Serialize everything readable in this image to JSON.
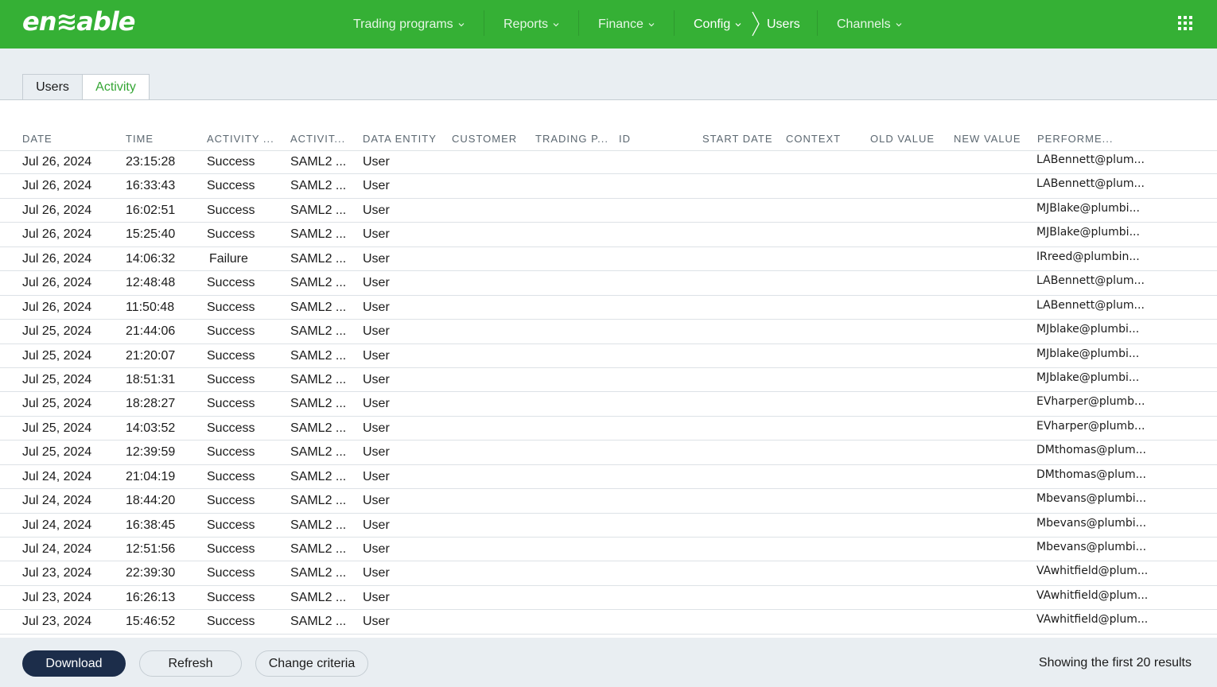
{
  "header": {
    "logo_text": "en≋able",
    "nav": [
      {
        "label": "Trading programs"
      },
      {
        "label": "Reports"
      },
      {
        "label": "Finance"
      },
      {
        "label": "Config"
      },
      {
        "label": "Users"
      },
      {
        "label": "Channels"
      }
    ],
    "brand_color": "#35b035"
  },
  "tabs": {
    "users": "Users",
    "activity": "Activity"
  },
  "table": {
    "columns": [
      "DATE",
      "TIME",
      "ACTIVITY ...",
      "ACTIVIT...",
      "DATA ENTITY",
      "CUSTOMER",
      "TRADING P...",
      "ID",
      "START DATE",
      "CONTEXT",
      "OLD VALUE",
      "NEW VALUE",
      "PERFORME..."
    ],
    "rows": [
      {
        "date": "Jul 26, 2024",
        "time": "23:15:28",
        "result": "Success",
        "activity": "SAML2 ...",
        "entity": "User",
        "performer": "LABennett@plum..."
      },
      {
        "date": "Jul 26, 2024",
        "time": "16:33:43",
        "result": "Success",
        "activity": "SAML2 ...",
        "entity": "User",
        "performer": "LABennett@plum..."
      },
      {
        "date": "Jul 26, 2024",
        "time": "16:02:51",
        "result": "Success",
        "activity": "SAML2 ...",
        "entity": "User",
        "performer": "MJBlake@plumbi..."
      },
      {
        "date": "Jul 26, 2024",
        "time": "15:25:40",
        "result": "Success",
        "activity": "SAML2 ...",
        "entity": "User",
        "performer": "MJBlake@plumbi..."
      },
      {
        "date": "Jul 26, 2024",
        "time": "14:06:32",
        "result": "Failure",
        "activity": "SAML2 ...",
        "entity": "User",
        "performer": "IRreed@plumbin..."
      },
      {
        "date": "Jul 26, 2024",
        "time": "12:48:48",
        "result": "Success",
        "activity": "SAML2 ...",
        "entity": "User",
        "performer": "LABennett@plum..."
      },
      {
        "date": "Jul 26, 2024",
        "time": "11:50:48",
        "result": "Success",
        "activity": "SAML2 ...",
        "entity": "User",
        "performer": "LABennett@plum..."
      },
      {
        "date": "Jul 25, 2024",
        "time": "21:44:06",
        "result": "Success",
        "activity": "SAML2 ...",
        "entity": "User",
        "performer": "MJblake@plumbi..."
      },
      {
        "date": "Jul 25, 2024",
        "time": "21:20:07",
        "result": "Success",
        "activity": "SAML2 ...",
        "entity": "User",
        "performer": "MJblake@plumbi..."
      },
      {
        "date": "Jul 25, 2024",
        "time": "18:51:31",
        "result": "Success",
        "activity": "SAML2 ...",
        "entity": "User",
        "performer": "MJblake@plumbi..."
      },
      {
        "date": "Jul 25, 2024",
        "time": "18:28:27",
        "result": "Success",
        "activity": "SAML2 ...",
        "entity": "User",
        "performer": "EVharper@plumb..."
      },
      {
        "date": "Jul 25, 2024",
        "time": "14:03:52",
        "result": "Success",
        "activity": "SAML2 ...",
        "entity": "User",
        "performer": "EVharper@plumb..."
      },
      {
        "date": "Jul 25, 2024",
        "time": "12:39:59",
        "result": "Success",
        "activity": "SAML2 ...",
        "entity": "User",
        "performer": "DMthomas@plum..."
      },
      {
        "date": "Jul 24, 2024",
        "time": "21:04:19",
        "result": "Success",
        "activity": "SAML2 ...",
        "entity": "User",
        "performer": "DMthomas@plum..."
      },
      {
        "date": "Jul 24, 2024",
        "time": "18:44:20",
        "result": "Success",
        "activity": "SAML2 ...",
        "entity": "User",
        "performer": "Mbevans@plumbi..."
      },
      {
        "date": "Jul 24, 2024",
        "time": "16:38:45",
        "result": "Success",
        "activity": "SAML2 ...",
        "entity": "User",
        "performer": "Mbevans@plumbi..."
      },
      {
        "date": "Jul 24, 2024",
        "time": "12:51:56",
        "result": "Success",
        "activity": "SAML2 ...",
        "entity": "User",
        "performer": "Mbevans@plumbi..."
      },
      {
        "date": "Jul 23, 2024",
        "time": "22:39:30",
        "result": "Success",
        "activity": "SAML2 ...",
        "entity": "User",
        "performer": "VAwhitfield@plum..."
      },
      {
        "date": "Jul 23, 2024",
        "time": "16:26:13",
        "result": "Success",
        "activity": "SAML2 ...",
        "entity": "User",
        "performer": "VAwhitfield@plum..."
      },
      {
        "date": "Jul 23, 2024",
        "time": "15:46:52",
        "result": "Success",
        "activity": "SAML2 ...",
        "entity": "User",
        "performer": "VAwhitfield@plum..."
      }
    ]
  },
  "footer": {
    "download": "Download",
    "refresh": "Refresh",
    "change_criteria": "Change criteria",
    "results_text": "Showing the first 20 results"
  }
}
